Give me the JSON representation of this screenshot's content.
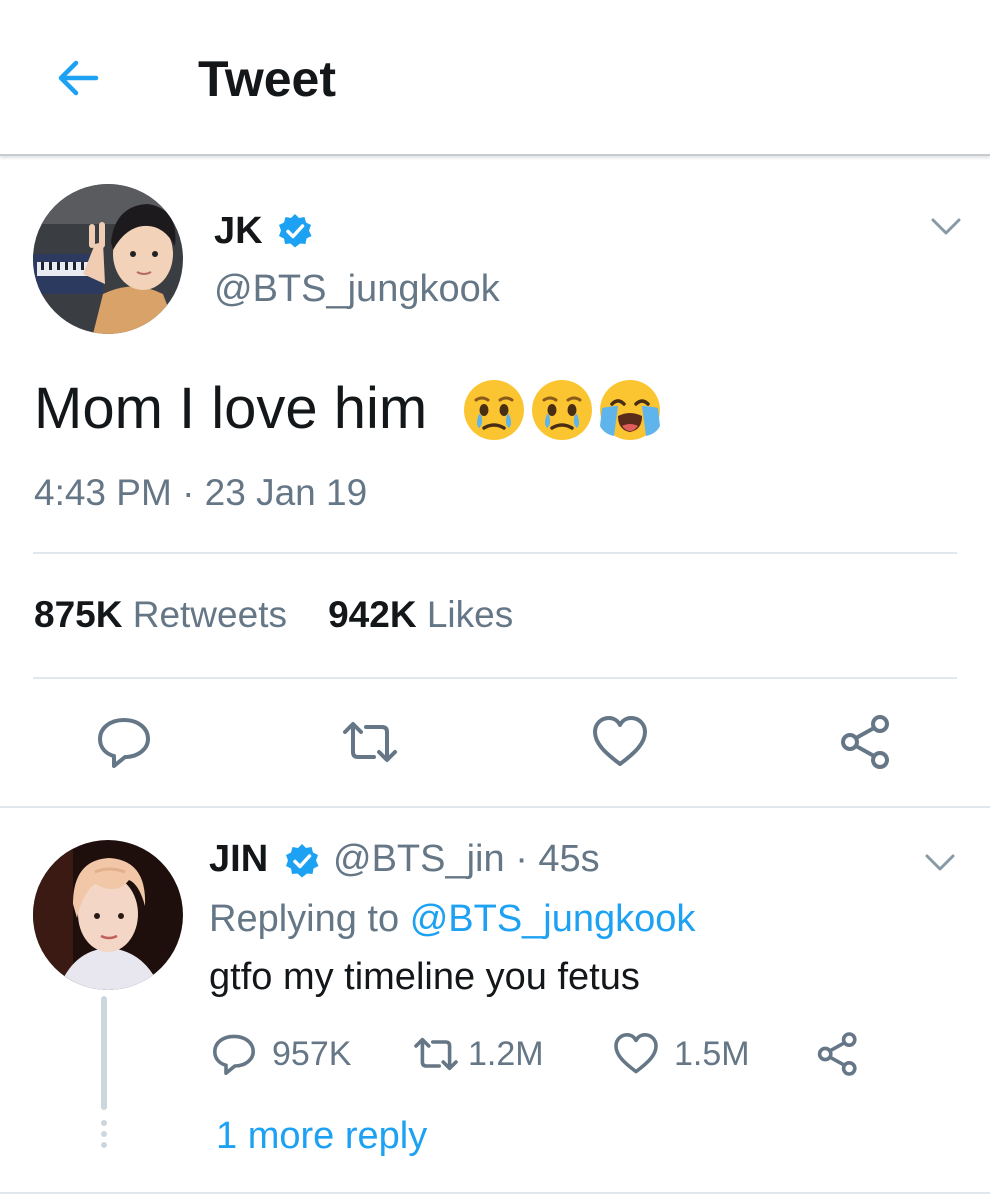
{
  "header": {
    "title": "Tweet",
    "back_icon": "arrow-left-icon"
  },
  "colors": {
    "accent": "#1da1f2",
    "secondary_text": "#657786",
    "primary_text": "#14171a",
    "divider": "#e1e8ed"
  },
  "tweet": {
    "author_name": "JK",
    "author_handle": "@BTS_jungkook",
    "verified": true,
    "text": "Mom I love him",
    "emojis": [
      "crying-face-icon",
      "crying-face-icon",
      "loudly-crying-face-icon"
    ],
    "timestamp": "4:43 PM · 23 Jan 19",
    "stats": {
      "retweets_count": "875K",
      "retweets_label": "Retweets",
      "likes_count": "942K",
      "likes_label": "Likes"
    },
    "actions": [
      "reply-icon",
      "retweet-icon",
      "like-icon",
      "share-icon"
    ]
  },
  "reply": {
    "author_name": "JIN",
    "verified": true,
    "handle_time": "@BTS_jin · 45s",
    "replying_prefix": "Replying to",
    "replying_to": "@BTS_jungkook",
    "text": "gtfo my timeline you fetus",
    "replies": "957K",
    "retweets": "1.2M",
    "likes": "1.5M",
    "more_replies": "1 more reply"
  }
}
